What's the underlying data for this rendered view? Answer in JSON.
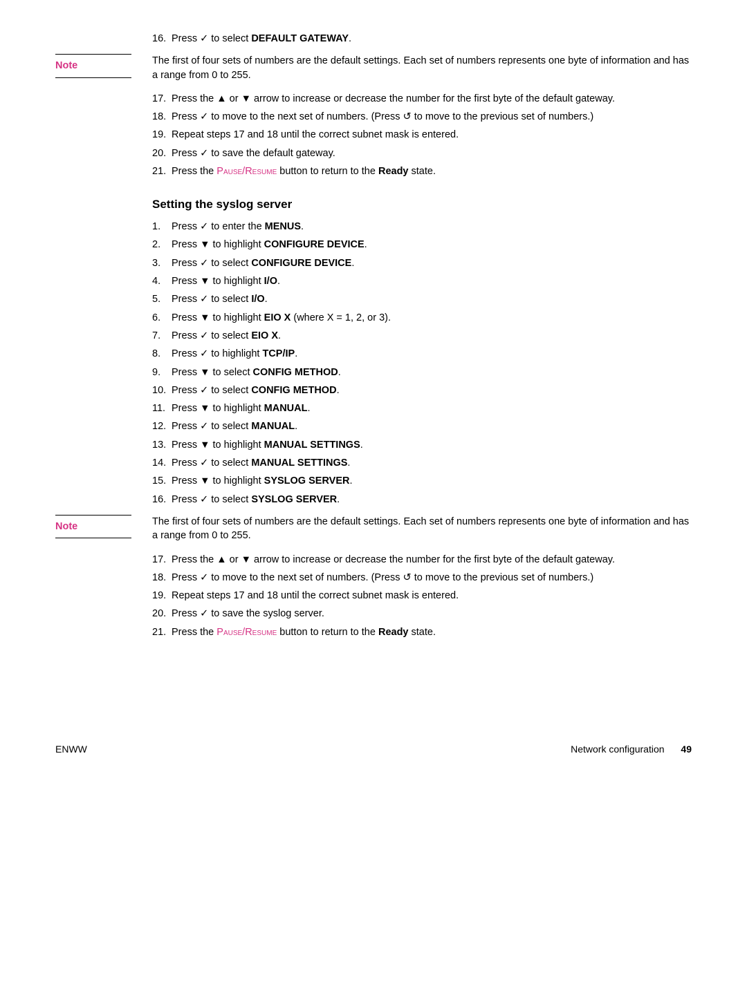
{
  "icons": {
    "check": "✓",
    "up": "▲",
    "down": "▼",
    "back": "↺"
  },
  "top_step": {
    "num": "16.",
    "pre": "Press ",
    "post": " to select ",
    "bold": "DEFAULT GATEWAY",
    "end": "."
  },
  "note1": {
    "label": "Note",
    "body": "The first of four sets of numbers are the default settings. Each set of numbers represents one byte of information and has a range from 0 to 255."
  },
  "group1": [
    {
      "num": "17.",
      "parts": [
        {
          "t": "Press the "
        },
        {
          "icon": "up"
        },
        {
          "t": " or "
        },
        {
          "icon": "down"
        },
        {
          "t": " arrow to increase or decrease the number for the first byte of the default gateway."
        }
      ]
    },
    {
      "num": "18.",
      "parts": [
        {
          "t": "Press "
        },
        {
          "icon": "check"
        },
        {
          "t": " to move to the next set of numbers. (Press "
        },
        {
          "icon": "back"
        },
        {
          "t": " to move to the previous set of numbers.)"
        }
      ]
    },
    {
      "num": "19.",
      "parts": [
        {
          "t": "Repeat steps 17 and 18 until the correct subnet mask is entered."
        }
      ]
    },
    {
      "num": "20.",
      "parts": [
        {
          "t": "Press "
        },
        {
          "icon": "check"
        },
        {
          "t": " to save the default gateway."
        }
      ]
    },
    {
      "num": "21.",
      "parts": [
        {
          "t": "Press the "
        },
        {
          "pink": "Pause/Resume"
        },
        {
          "t": " button to return to the "
        },
        {
          "b": "Ready"
        },
        {
          "t": " state."
        }
      ]
    }
  ],
  "section_title": "Setting the syslog server",
  "group2": [
    {
      "num": "1.",
      "parts": [
        {
          "t": "Press "
        },
        {
          "icon": "check"
        },
        {
          "t": " to enter the "
        },
        {
          "b": "MENUS"
        },
        {
          "t": "."
        }
      ]
    },
    {
      "num": "2.",
      "parts": [
        {
          "t": "Press "
        },
        {
          "icon": "down"
        },
        {
          "t": " to highlight "
        },
        {
          "b": "CONFIGURE DEVICE"
        },
        {
          "t": "."
        }
      ]
    },
    {
      "num": "3.",
      "parts": [
        {
          "t": "Press "
        },
        {
          "icon": "check"
        },
        {
          "t": " to select "
        },
        {
          "b": "CONFIGURE DEVICE"
        },
        {
          "t": "."
        }
      ]
    },
    {
      "num": "4.",
      "parts": [
        {
          "t": "Press "
        },
        {
          "icon": "down"
        },
        {
          "t": " to highlight "
        },
        {
          "b": "I/O"
        },
        {
          "t": "."
        }
      ]
    },
    {
      "num": "5.",
      "parts": [
        {
          "t": "Press "
        },
        {
          "icon": "check"
        },
        {
          "t": " to select "
        },
        {
          "b": "I/O"
        },
        {
          "t": "."
        }
      ]
    },
    {
      "num": "6.",
      "parts": [
        {
          "t": "Press "
        },
        {
          "icon": "down"
        },
        {
          "t": " to highlight "
        },
        {
          "b": "EIO X"
        },
        {
          "t": " (where X = 1, 2, or 3)."
        }
      ]
    },
    {
      "num": "7.",
      "parts": [
        {
          "t": "Press "
        },
        {
          "icon": "check"
        },
        {
          "t": " to select "
        },
        {
          "b": "EIO X"
        },
        {
          "t": "."
        }
      ]
    },
    {
      "num": "8.",
      "parts": [
        {
          "t": "Press "
        },
        {
          "icon": "check"
        },
        {
          "t": " to highlight "
        },
        {
          "b": "TCP/IP"
        },
        {
          "t": "."
        }
      ]
    },
    {
      "num": "9.",
      "parts": [
        {
          "t": "Press "
        },
        {
          "icon": "down"
        },
        {
          "t": " to select "
        },
        {
          "b": "CONFIG METHOD"
        },
        {
          "t": "."
        }
      ]
    },
    {
      "num": "10.",
      "parts": [
        {
          "t": "Press "
        },
        {
          "icon": "check"
        },
        {
          "t": " to select "
        },
        {
          "b": "CONFIG METHOD"
        },
        {
          "t": "."
        }
      ]
    },
    {
      "num": "11.",
      "parts": [
        {
          "t": "Press "
        },
        {
          "icon": "down"
        },
        {
          "t": " to highlight "
        },
        {
          "b": "MANUAL"
        },
        {
          "t": "."
        }
      ]
    },
    {
      "num": "12.",
      "parts": [
        {
          "t": "Press "
        },
        {
          "icon": "check"
        },
        {
          "t": " to select "
        },
        {
          "b": "MANUAL"
        },
        {
          "t": "."
        }
      ]
    },
    {
      "num": "13.",
      "parts": [
        {
          "t": "Press "
        },
        {
          "icon": "down"
        },
        {
          "t": " to highlight "
        },
        {
          "b": "MANUAL SETTINGS"
        },
        {
          "t": "."
        }
      ]
    },
    {
      "num": "14.",
      "parts": [
        {
          "t": "Press "
        },
        {
          "icon": "check"
        },
        {
          "t": " to select "
        },
        {
          "b": "MANUAL SETTINGS"
        },
        {
          "t": "."
        }
      ]
    },
    {
      "num": "15.",
      "parts": [
        {
          "t": "Press "
        },
        {
          "icon": "down"
        },
        {
          "t": " to highlight "
        },
        {
          "b": "SYSLOG SERVER"
        },
        {
          "t": "."
        }
      ]
    },
    {
      "num": "16.",
      "parts": [
        {
          "t": "Press "
        },
        {
          "icon": "check"
        },
        {
          "t": " to select "
        },
        {
          "b": "SYSLOG SERVER"
        },
        {
          "t": "."
        }
      ]
    }
  ],
  "note2": {
    "label": "Note",
    "body": "The first of four sets of numbers are the default settings. Each set of numbers represents one byte of information and has a range from 0 to 255."
  },
  "group3": [
    {
      "num": "17.",
      "parts": [
        {
          "t": "Press the "
        },
        {
          "icon": "up"
        },
        {
          "t": " or "
        },
        {
          "icon": "down"
        },
        {
          "t": " arrow to increase or decrease the number for the first byte of the default gateway."
        }
      ]
    },
    {
      "num": "18.",
      "parts": [
        {
          "t": "Press "
        },
        {
          "icon": "check"
        },
        {
          "t": " to move to the next set of numbers. (Press "
        },
        {
          "icon": "back"
        },
        {
          "t": " to move to the previous set of numbers.)"
        }
      ]
    },
    {
      "num": "19.",
      "parts": [
        {
          "t": "Repeat steps 17 and 18 until the correct subnet mask is entered."
        }
      ]
    },
    {
      "num": "20.",
      "parts": [
        {
          "t": "Press "
        },
        {
          "icon": "check"
        },
        {
          "t": " to save the syslog server."
        }
      ]
    },
    {
      "num": "21.",
      "parts": [
        {
          "t": "Press the "
        },
        {
          "pink": "Pause/Resume"
        },
        {
          "t": " button to return to the "
        },
        {
          "b": "Ready"
        },
        {
          "t": " state."
        }
      ]
    }
  ],
  "footer": {
    "left": "ENWW",
    "right_label": "Network configuration",
    "page": "49"
  }
}
